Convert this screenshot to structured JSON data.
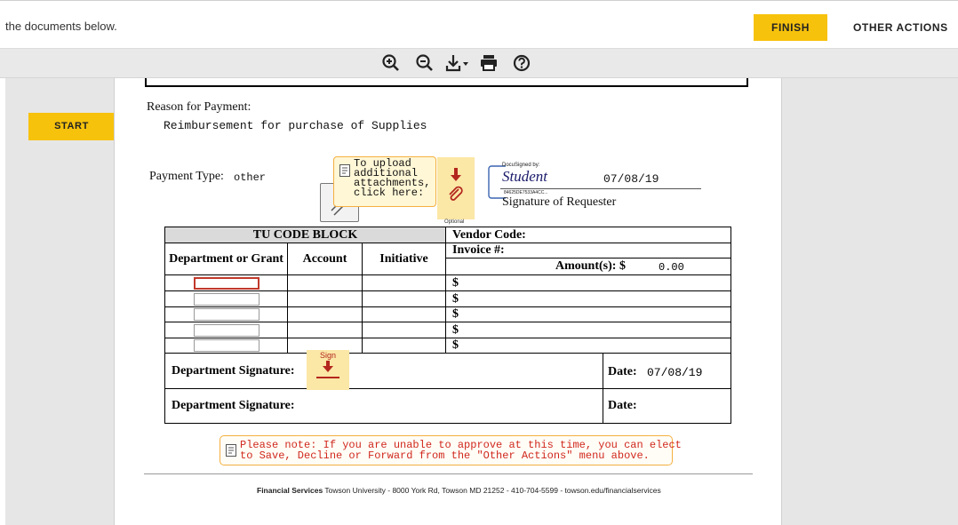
{
  "topbar": {
    "message": "the documents below.",
    "finish_label": "FINISH",
    "other_actions_label": "OTHER ACTIONS"
  },
  "toolbar": {
    "icons": [
      "zoom-in-icon",
      "zoom-out-icon",
      "download-icon",
      "print-icon",
      "help-icon"
    ]
  },
  "sidebar": {
    "start_label": "START"
  },
  "document": {
    "reason_label": "Reason for Payment:",
    "reason_value": "Reimbursement for purchase of Supplies",
    "payment_type_label": "Payment Type:",
    "payment_type_value": "other",
    "tooltip_text": "To upload\nadditional\nattachments,\nclick here:",
    "optional_label": "Optional",
    "signature": {
      "docusigned_label": "DocuSigned by:",
      "name": "Student",
      "hash": "84625DE7533A4CC...",
      "date": "07/08/19",
      "caption": "Signature of Requester"
    },
    "table": {
      "tu_code_block": "TU CODE BLOCK",
      "vendor_code": "Vendor Code:",
      "invoice": "Invoice #:",
      "col_department": "Department or Grant",
      "col_account": "Account",
      "col_initiative": "Initiative",
      "amounts_label": "Amount(s): $",
      "amounts_value": "0.00",
      "dollar": "$",
      "dept_signature_label": "Department Signature:",
      "sign_label": "Sign",
      "date_label": "Date:",
      "date_value": "07/08/19"
    },
    "note_text": "Please note: If you are unable to approve at this time, you can elect\nto Save, Decline or Forward from the \"Other Actions\" menu above.",
    "footer_bold": "Financial Services",
    "footer_text": "Towson University - 8000 York Rd, Towson MD 21252 - 410-704-5599 - towson.edu/financialservices"
  },
  "colors": {
    "accent": "#f7c20c",
    "note_text": "#d0281e",
    "note_border": "#f4b041",
    "arrow": "#b3261e"
  }
}
